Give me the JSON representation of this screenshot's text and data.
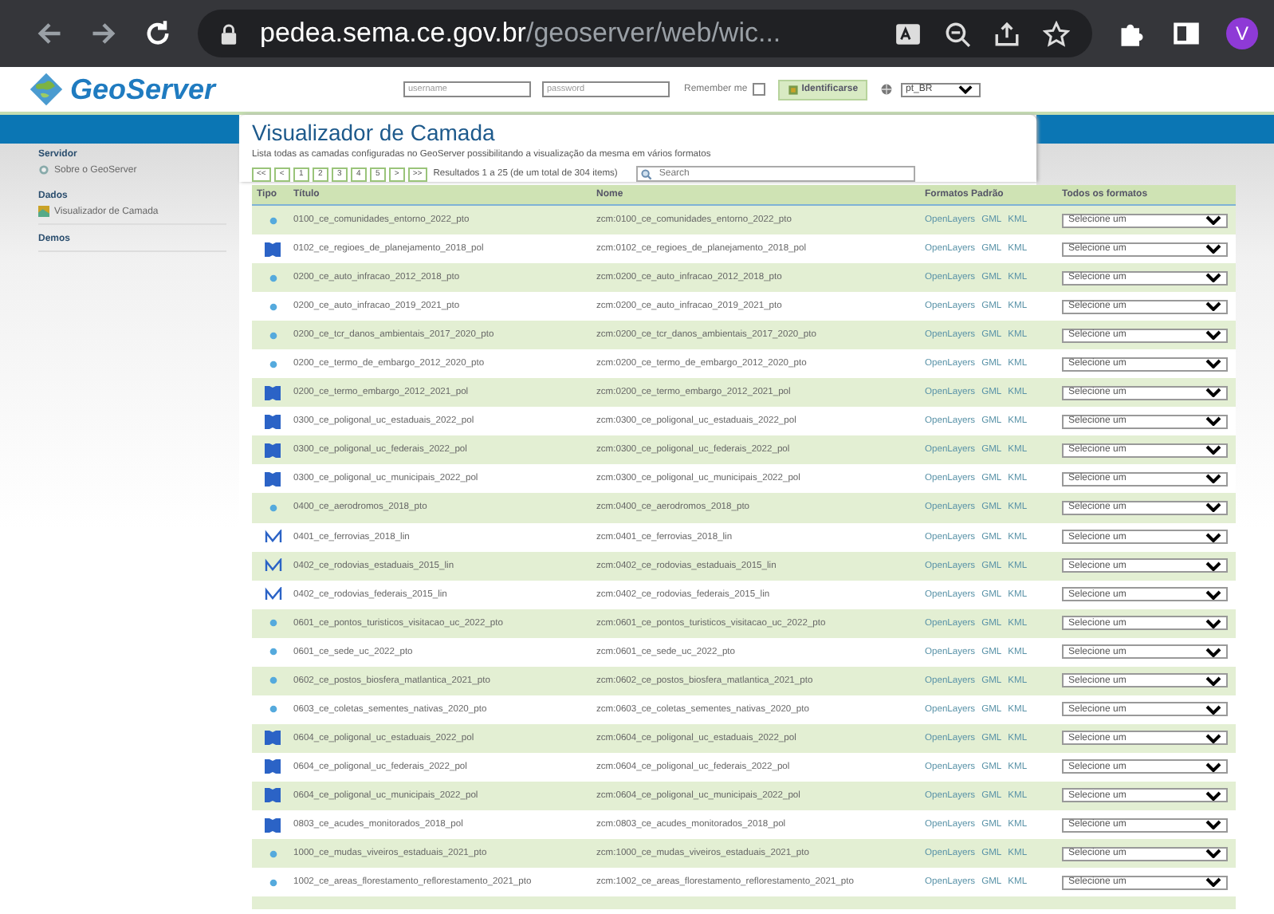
{
  "browser": {
    "url_host": "pedea.sema.ce.gov.br",
    "url_path": "/geoserver/web/wic...",
    "avatar": "V"
  },
  "header": {
    "logo": "GeoServer",
    "username": {
      "placeholder": "username"
    },
    "password": {
      "placeholder": "password"
    },
    "remember": {
      "label": "Remember me",
      "checked": false
    },
    "login_button": "Identificarse",
    "language": "pt_BR"
  },
  "sidebar": {
    "sections": [
      {
        "title": "Servidor",
        "items": [
          {
            "label": "Sobre o GeoServer"
          }
        ]
      },
      {
        "title": "Dados",
        "items": [
          {
            "label": "Visualizador de Camada"
          }
        ]
      },
      {
        "title": "Demos"
      }
    ]
  },
  "page": {
    "title": "Visualizador de Camada",
    "description": "Lista todas as camadas configuradas no GeoServer possibilitando a visualização da mesma em vários formatos",
    "pager": [
      "<<",
      "<",
      "1",
      "2",
      "3",
      "4",
      "5",
      ">",
      ">>"
    ],
    "results": "Resultados 1 a 25 (de um total de 304 items)",
    "search": {
      "placeholder": "Search"
    }
  },
  "table": {
    "columns": [
      "Tipo",
      "Título",
      "Nome",
      "Formatos Padrão",
      "Todos os formatos"
    ],
    "rows": [
      {
        "kind": "point",
        "title": "0100_ce_comunidades_entorno_2022_pto",
        "name": "zcm:0100_ce_comunidades_entorno_2022_pto",
        "formats": [
          "OpenLayers",
          "GML",
          "KML"
        ],
        "select": "Selecione um"
      },
      {
        "kind": "polygon",
        "title": "0102_ce_regioes_de_planejamento_2018_pol",
        "name": "zcm:0102_ce_regioes_de_planejamento_2018_pol",
        "formats": [
          "OpenLayers",
          "GML",
          "KML"
        ],
        "select": "Selecione um"
      },
      {
        "kind": "point",
        "title": "0200_ce_auto_infracao_2012_2018_pto",
        "name": "zcm:0200_ce_auto_infracao_2012_2018_pto",
        "formats": [
          "OpenLayers",
          "GML",
          "KML"
        ],
        "select": "Selecione um"
      },
      {
        "kind": "point",
        "title": "0200_ce_auto_infracao_2019_2021_pto",
        "name": "zcm:0200_ce_auto_infracao_2019_2021_pto",
        "formats": [
          "OpenLayers",
          "GML",
          "KML"
        ],
        "select": "Selecione um"
      },
      {
        "kind": "point",
        "title": "0200_ce_tcr_danos_ambientais_2017_2020_pto",
        "name": "zcm:0200_ce_tcr_danos_ambientais_2017_2020_pto",
        "formats": [
          "OpenLayers",
          "GML",
          "KML"
        ],
        "select": "Selecione um"
      },
      {
        "kind": "point",
        "title": "0200_ce_termo_de_embargo_2012_2020_pto",
        "name": "zcm:0200_ce_termo_de_embargo_2012_2020_pto",
        "formats": [
          "OpenLayers",
          "GML",
          "KML"
        ],
        "select": "Selecione um"
      },
      {
        "kind": "polygon",
        "title": "0200_ce_termo_embargo_2012_2021_pol",
        "name": "zcm:0200_ce_termo_embargo_2012_2021_pol",
        "formats": [
          "OpenLayers",
          "GML",
          "KML"
        ],
        "select": "Selecione um"
      },
      {
        "kind": "polygon",
        "title": "0300_ce_poligonal_uc_estaduais_2022_pol",
        "name": "zcm:0300_ce_poligonal_uc_estaduais_2022_pol",
        "formats": [
          "OpenLayers",
          "GML",
          "KML"
        ],
        "select": "Selecione um"
      },
      {
        "kind": "polygon",
        "title": "0300_ce_poligonal_uc_federais_2022_pol",
        "name": "zcm:0300_ce_poligonal_uc_federais_2022_pol",
        "formats": [
          "OpenLayers",
          "GML",
          "KML"
        ],
        "select": "Selecione um"
      },
      {
        "kind": "polygon",
        "title": "0300_ce_poligonal_uc_municipais_2022_pol",
        "name": "zcm:0300_ce_poligonal_uc_municipais_2022_pol",
        "formats": [
          "OpenLayers",
          "GML",
          "KML"
        ],
        "select": "Selecione um"
      },
      {
        "kind": "point",
        "title": "0400_ce_aerodromos_2018_pto",
        "name": "zcm:0400_ce_aerodromos_2018_pto",
        "formats": [
          "OpenLayers",
          "GML",
          "KML"
        ],
        "select": "Selecione um"
      },
      {
        "kind": "line",
        "title": "0401_ce_ferrovias_2018_lin",
        "name": "zcm:0401_ce_ferrovias_2018_lin",
        "formats": [
          "OpenLayers",
          "GML",
          "KML"
        ],
        "select": "Selecione um"
      },
      {
        "kind": "line",
        "title": "0402_ce_rodovias_estaduais_2015_lin",
        "name": "zcm:0402_ce_rodovias_estaduais_2015_lin",
        "formats": [
          "OpenLayers",
          "GML",
          "KML"
        ],
        "select": "Selecione um"
      },
      {
        "kind": "line",
        "title": "0402_ce_rodovias_federais_2015_lin",
        "name": "zcm:0402_ce_rodovias_federais_2015_lin",
        "formats": [
          "OpenLayers",
          "GML",
          "KML"
        ],
        "select": "Selecione um"
      },
      {
        "kind": "point",
        "title": "0601_ce_pontos_turisticos_visitacao_uc_2022_pto",
        "name": "zcm:0601_ce_pontos_turisticos_visitacao_uc_2022_pto",
        "formats": [
          "OpenLayers",
          "GML",
          "KML"
        ],
        "select": "Selecione um"
      },
      {
        "kind": "point",
        "title": "0601_ce_sede_uc_2022_pto",
        "name": "zcm:0601_ce_sede_uc_2022_pto",
        "formats": [
          "OpenLayers",
          "GML",
          "KML"
        ],
        "select": "Selecione um"
      },
      {
        "kind": "point",
        "title": "0602_ce_postos_biosfera_matlantica_2021_pto",
        "name": "zcm:0602_ce_postos_biosfera_matlantica_2021_pto",
        "formats": [
          "OpenLayers",
          "GML",
          "KML"
        ],
        "select": "Selecione um"
      },
      {
        "kind": "point",
        "title": "0603_ce_coletas_sementes_nativas_2020_pto",
        "name": "zcm:0603_ce_coletas_sementes_nativas_2020_pto",
        "formats": [
          "OpenLayers",
          "GML",
          "KML"
        ],
        "select": "Selecione um"
      },
      {
        "kind": "polygon",
        "title": "0604_ce_poligonal_uc_estaduais_2022_pol",
        "name": "zcm:0604_ce_poligonal_uc_estaduais_2022_pol",
        "formats": [
          "OpenLayers",
          "GML",
          "KML"
        ],
        "select": "Selecione um"
      },
      {
        "kind": "polygon",
        "title": "0604_ce_poligonal_uc_federais_2022_pol",
        "name": "zcm:0604_ce_poligonal_uc_federais_2022_pol",
        "formats": [
          "OpenLayers",
          "GML",
          "KML"
        ],
        "select": "Selecione um"
      },
      {
        "kind": "polygon",
        "title": "0604_ce_poligonal_uc_municipais_2022_pol",
        "name": "zcm:0604_ce_poligonal_uc_municipais_2022_pol",
        "formats": [
          "OpenLayers",
          "GML",
          "KML"
        ],
        "select": "Selecione um"
      },
      {
        "kind": "polygon",
        "title": "0803_ce_acudes_monitorados_2018_pol",
        "name": "zcm:0803_ce_acudes_monitorados_2018_pol",
        "formats": [
          "OpenLayers",
          "GML",
          "KML"
        ],
        "select": "Selecione um"
      },
      {
        "kind": "point",
        "title": "1000_ce_mudas_viveiros_estaduais_2021_pto",
        "name": "zcm:1000_ce_mudas_viveiros_estaduais_2021_pto",
        "formats": [
          "OpenLayers",
          "GML",
          "KML"
        ],
        "select": "Selecione um"
      },
      {
        "kind": "point",
        "title": "1002_ce_areas_florestamento_reflorestamento_2021_pto",
        "name": "zcm:1002_ce_areas_florestamento_reflorestamento_2021_pto",
        "formats": [
          "OpenLayers",
          "GML",
          "KML"
        ],
        "select": "Selecione um"
      }
    ]
  }
}
